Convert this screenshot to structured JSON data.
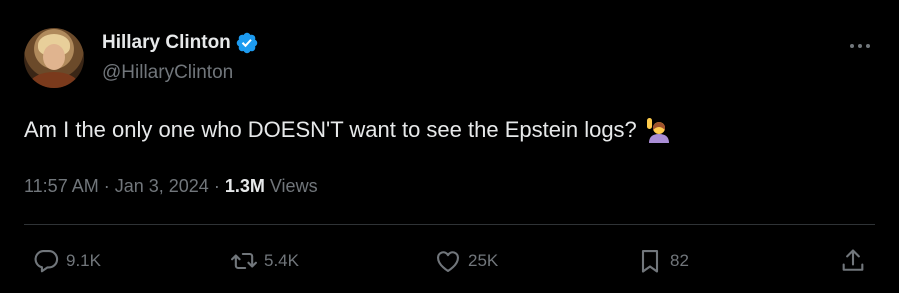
{
  "author": {
    "display_name": "Hillary Clinton",
    "handle": "@HillaryClinton",
    "verified_color": "#1d9bf0"
  },
  "tweet": {
    "text": "Am I the only one who DOESN'T want to see the Epstein logs?",
    "emoji": "person-raising-hand-emoji"
  },
  "meta": {
    "time": "11:57 AM",
    "date": "Jan 3, 2024",
    "views_count": "1.3M",
    "views_label": "Views"
  },
  "actions": {
    "replies": "9.1K",
    "reposts": "5.4K",
    "likes": "25K",
    "bookmarks": "82"
  },
  "colors": {
    "background": "#000000",
    "primary_text": "#e7e9ea",
    "secondary_text": "#71767b",
    "divider": "#2f3336"
  }
}
